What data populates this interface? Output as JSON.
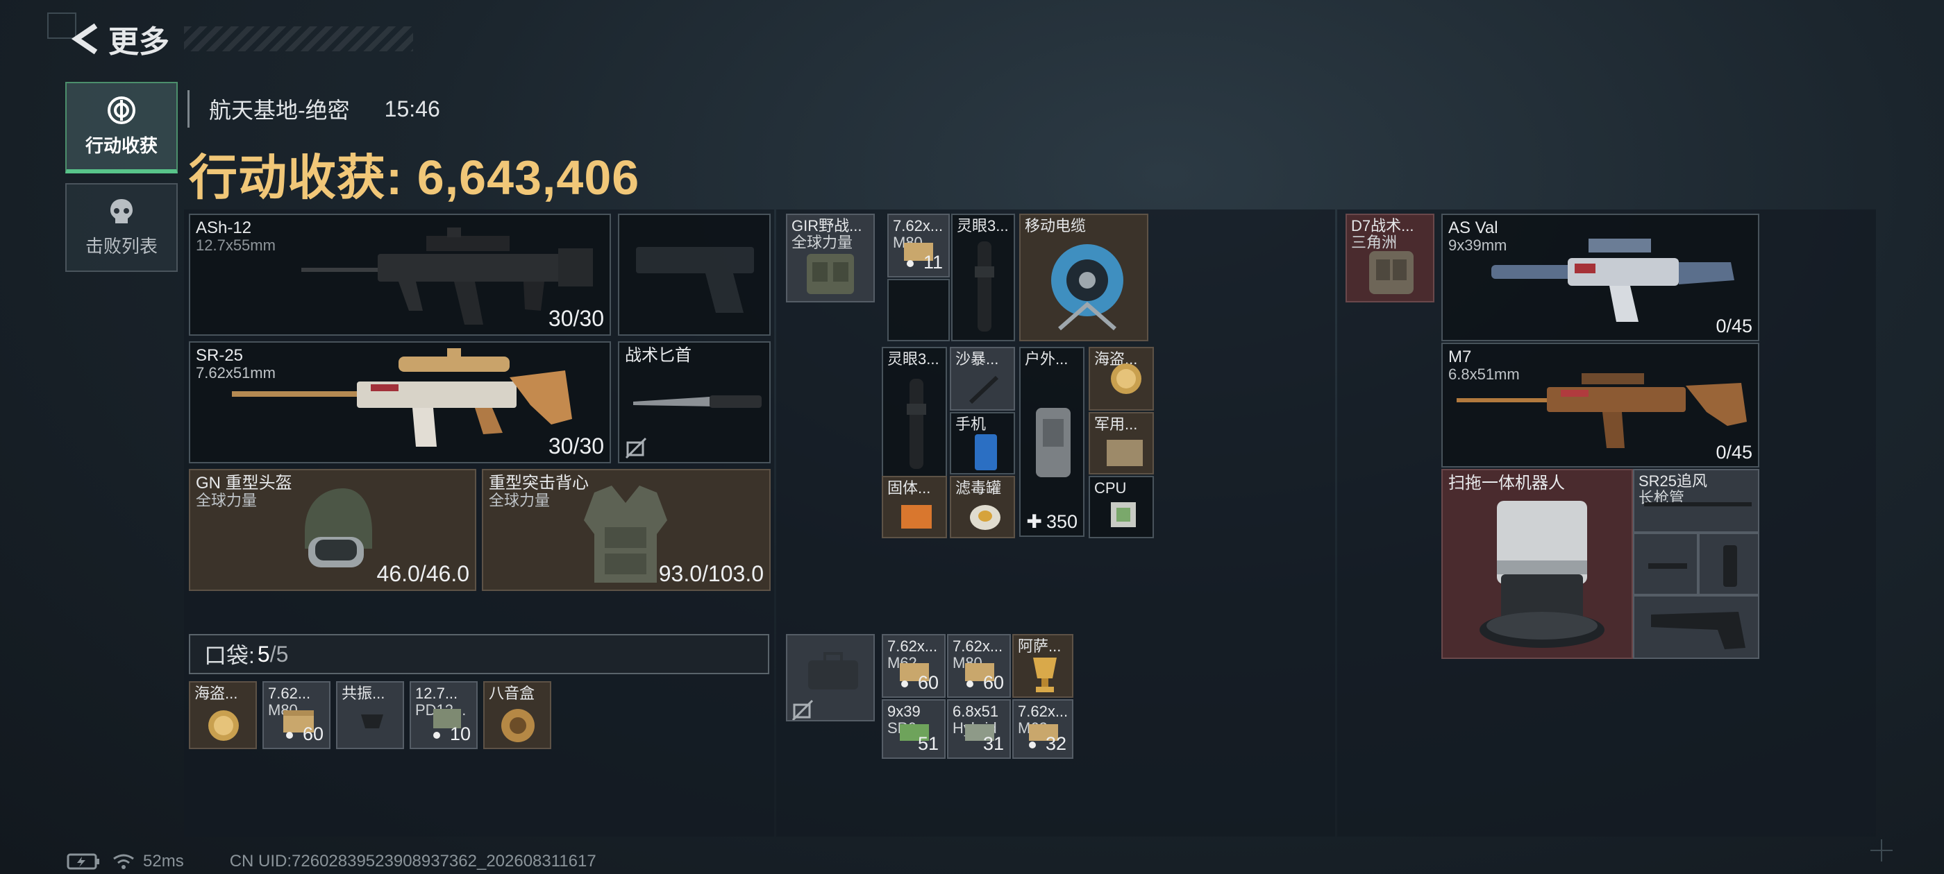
{
  "header": {
    "title": "更多"
  },
  "side_tabs": [
    {
      "label": "行动收获",
      "icon": "target-icon"
    },
    {
      "label": "击败列表",
      "icon": "skull-icon"
    }
  ],
  "raid": {
    "map": "航天基地-绝密",
    "time": "15:46"
  },
  "haul": {
    "label": "行动收获:",
    "value": "6,643,406"
  },
  "loadout": {
    "primary1": {
      "name": "ASh-12",
      "caliber": "12.7x55mm",
      "ammo": "30/30"
    },
    "primary2": {
      "name": "SR-25",
      "caliber": "7.62x51mm",
      "ammo": "30/30"
    },
    "melee": {
      "name": "战术匕首"
    },
    "helmet": {
      "name": "GN 重型头盔",
      "source": "全球力量",
      "durability": "46.0/46.0"
    },
    "armor": {
      "name": "重型突击背心",
      "source": "全球力量",
      "durability": "93.0/103.0"
    }
  },
  "pocket": {
    "label": "口袋:",
    "used": "5",
    "total": "/5"
  },
  "pocket_items": [
    {
      "name": "海盗...",
      "sub": "",
      "count": ""
    },
    {
      "name": "7.62...",
      "sub": "M80",
      "count": "60"
    },
    {
      "name": "共振...",
      "sub": "",
      "count": ""
    },
    {
      "name": "12.7...",
      "sub": "PD12...",
      "count": "10"
    },
    {
      "name": "八音盒",
      "sub": "",
      "count": ""
    }
  ],
  "chest_rig": {
    "name": "GIR野战...",
    "source": "全球力量"
  },
  "rig_items": [
    {
      "name": "7.62x...",
      "sub": "M80",
      "count": "11"
    },
    {
      "name": "灵眼3...",
      "sub": "",
      "count": ""
    },
    {
      "name": "移动电缆",
      "sub": "",
      "count": ""
    }
  ],
  "backpack_items": [
    {
      "name": "灵眼3...",
      "sub": "",
      "count": ""
    },
    {
      "name": "沙暴...",
      "sub": "",
      "count": ""
    },
    {
      "name": "户外...",
      "sub": "",
      "count": "350"
    },
    {
      "name": "海盗...",
      "sub": "",
      "count": ""
    },
    {
      "name": "手机",
      "sub": "",
      "count": ""
    },
    {
      "name": "军用...",
      "sub": "",
      "count": ""
    },
    {
      "name": "固体...",
      "sub": "",
      "count": ""
    },
    {
      "name": "滤毒罐",
      "sub": "",
      "count": ""
    },
    {
      "name": "CPU",
      "sub": "",
      "count": ""
    }
  ],
  "case_items": [
    {
      "name": "7.62x...",
      "sub": "M62",
      "count": "60"
    },
    {
      "name": "7.62x...",
      "sub": "M80",
      "count": "60"
    },
    {
      "name": "阿萨...",
      "sub": "",
      "count": ""
    },
    {
      "name": "9x39",
      "sub": "SP6",
      "count": "51"
    },
    {
      "name": "6.8x51",
      "sub": "Hybrid",
      "count": "31"
    },
    {
      "name": "7.62x...",
      "sub": "M62",
      "count": "32"
    }
  ],
  "loot": {
    "rig": {
      "name": "D7战术...",
      "source": "三角洲"
    },
    "weapon1": {
      "name": "AS Val",
      "caliber": "9x39mm",
      "ammo": "0/45"
    },
    "weapon2": {
      "name": "M7",
      "caliber": "6.8x51mm",
      "ammo": "0/45"
    },
    "robot": {
      "name": "扫拖一体机器人"
    },
    "barrel": {
      "name": "SR25追风",
      "sub": "长枪管"
    }
  },
  "footer": {
    "ping": "52ms",
    "uid": "CN UID:7260283952390893736​2_202608311617"
  },
  "colors": {
    "gold": "#f1c778",
    "active_tab": "#58c48a",
    "brown_slot": "#3b332a",
    "red_slot": "#4a2b2e"
  }
}
